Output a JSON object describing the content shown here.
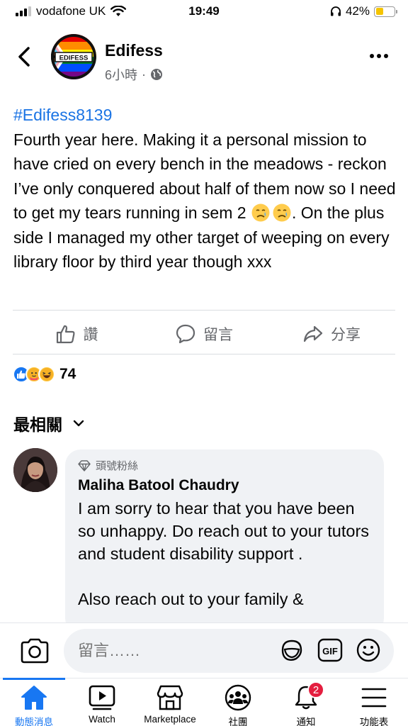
{
  "status_bar": {
    "carrier": "vodafone UK",
    "time": "19:49",
    "battery_percent": "42%",
    "battery_level": 0.42,
    "icons": [
      "signal-icon",
      "wifi-icon",
      "headphones-icon",
      "battery-icon"
    ]
  },
  "header": {
    "page_name": "Edifess",
    "avatar_text": "EDIFESS",
    "time_ago": "6小時",
    "separator": "·",
    "icons": [
      "back-icon",
      "globe-icon",
      "more-icon"
    ]
  },
  "post": {
    "hashtag": "#Edifess8139",
    "text_part1": "Fourth year here. Making it a personal mission to have cried on every bench in the meadows - reckon I’ve only conquered about half of them now so I need to get my tears running in sem 2 ",
    "text_part2": ". On the plus side I managed my other target of weeping on every library floor by third year though xxx"
  },
  "actions": {
    "like": "讚",
    "comment": "留言",
    "share": "分享"
  },
  "reactions": {
    "count": "74",
    "icons": [
      "like-reaction-icon",
      "care-reaction-icon",
      "haha-reaction-icon"
    ]
  },
  "comments_sort": {
    "label": "最相關"
  },
  "comment": {
    "badge": "頭號粉絲",
    "author": "Maliha Batool Chaudry",
    "text": "I am sorry to hear that you have been so unhappy. Do reach out to your tutors and student disability support .\n\nAlso reach out to your family &"
  },
  "composer": {
    "placeholder": "留言……",
    "gif_label": "GIF"
  },
  "bottom_nav": {
    "items": [
      {
        "label": "動態消息",
        "icon": "home-icon"
      },
      {
        "label": "Watch",
        "icon": "watch-icon"
      },
      {
        "label": "Marketplace",
        "icon": "marketplace-icon"
      },
      {
        "label": "社團",
        "icon": "groups-icon"
      },
      {
        "label": "通知",
        "icon": "bell-icon",
        "badge": "2"
      },
      {
        "label": "功能表",
        "icon": "menu-icon"
      }
    ]
  },
  "colors": {
    "accent": "#1877f2",
    "hashtag": "#1b74e4",
    "secondary_text": "#65676b",
    "bubble": "#f0f2f5",
    "notification_badge": "#e41e3f"
  }
}
